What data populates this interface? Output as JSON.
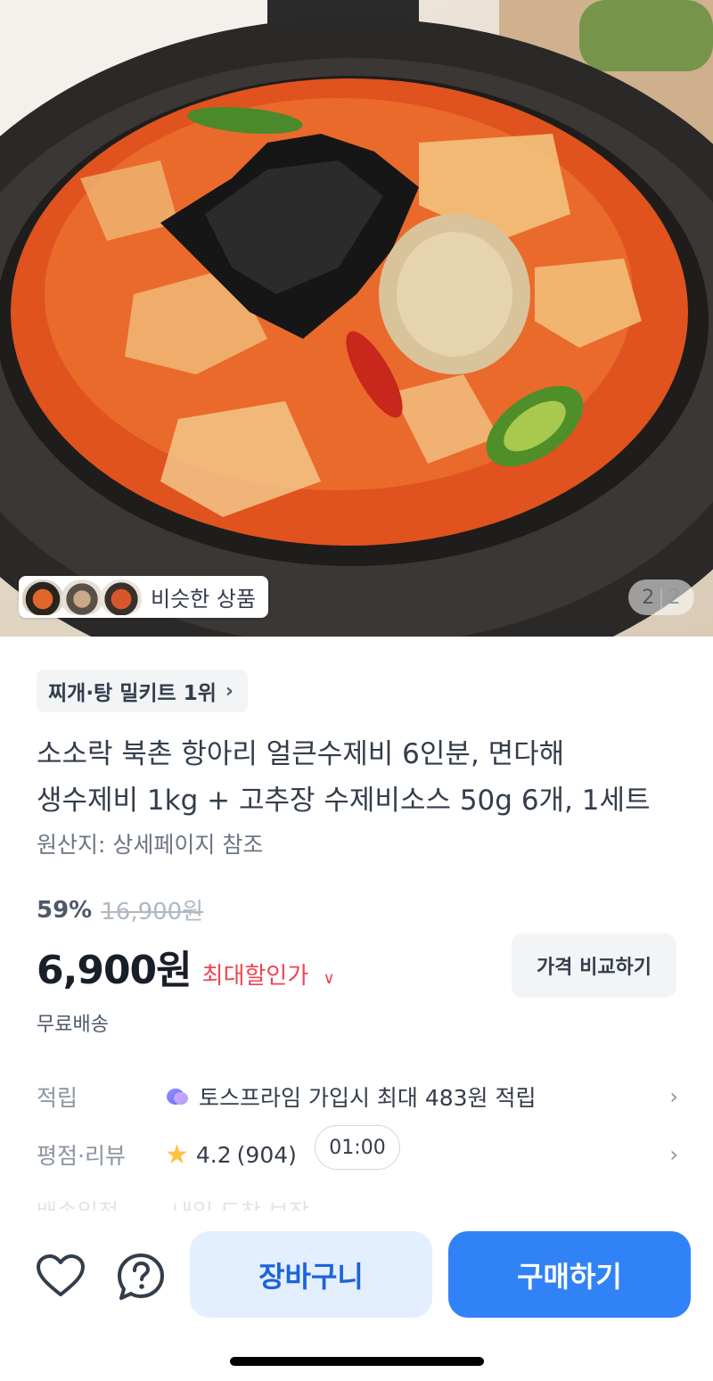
{
  "hero": {
    "similar_products_label": "비슷한 상품",
    "page_current": "2",
    "page_total": "2"
  },
  "product": {
    "rank_chip": "찌개·탕 밀키트 1위",
    "title_line1": "소소락 북촌 항아리 얼큰수제비 6인분, 면다해",
    "title_line2": "생수제비 1kg + 고추장 수제비소스 50g 6개, 1세트",
    "origin": "원산지: 상세페이지 참조",
    "discount_rate": "59%",
    "original_price": "16,900원",
    "price": "6,900원",
    "max_discount_label": "최대할인가",
    "compare_button": "가격 비교하기",
    "shipping": "무료배송"
  },
  "info_rows": {
    "points_label": "적립",
    "points_value": "토스프라임 가입시 최대 483원 적립",
    "rating_label": "평점·리뷰",
    "rating_value": "4.2",
    "review_count": "(904)",
    "timer": "01:00",
    "faded_label": "배송일정",
    "faded_value": "내일 도착 보장"
  },
  "bottom_bar": {
    "cart_label": "장바구니",
    "buy_label": "구매하기"
  },
  "icons": {
    "favorite": "heart-outline-icon",
    "help": "question-circle-icon",
    "chevron": "chevron-right-icon"
  },
  "colors": {
    "primary": "#3182f6",
    "cart_bg": "#e3eeff",
    "cart_text": "#1b64da",
    "discount_red": "#f04452",
    "star": "#ffc342"
  }
}
